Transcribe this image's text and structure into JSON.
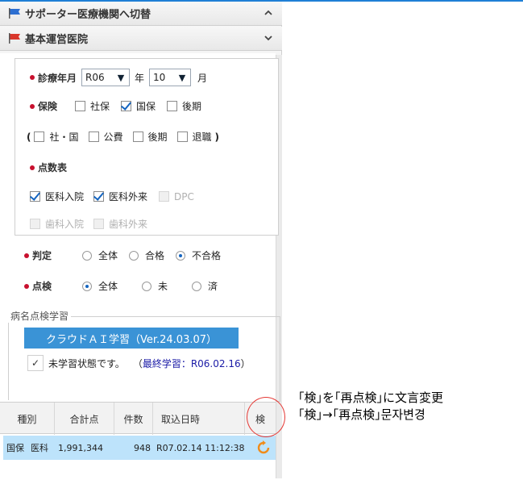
{
  "header1": {
    "title": "サポーター医療機関へ切替",
    "chevron": "up-chevron"
  },
  "header2": {
    "title": "基本運営医院",
    "chevron": "down-chevron"
  },
  "shinryo": {
    "label": "診療年月",
    "year_value": "R06",
    "year_unit": "年",
    "month_value": "10",
    "month_unit": "月"
  },
  "hoken": {
    "label": "保険",
    "options": [
      {
        "label": "社保",
        "checked": false
      },
      {
        "label": "国保",
        "checked": true
      },
      {
        "label": "後期",
        "checked": false
      }
    ],
    "paren_open": "(",
    "paren_close": ")",
    "sub_options": [
      {
        "label": "社・国",
        "checked": false
      },
      {
        "label": "公費",
        "checked": false
      },
      {
        "label": "後期",
        "checked": false
      },
      {
        "label": "退職",
        "checked": false
      }
    ]
  },
  "tensu": {
    "label": "点数表",
    "options": [
      {
        "label": "医科入院",
        "checked": true,
        "disabled": false
      },
      {
        "label": "医科外来",
        "checked": true,
        "disabled": false
      },
      {
        "label": "DPC",
        "checked": false,
        "disabled": true
      },
      {
        "label": "歯科入院",
        "checked": false,
        "disabled": true
      },
      {
        "label": "歯科外来",
        "checked": false,
        "disabled": true
      }
    ]
  },
  "hantei": {
    "label": "判定",
    "options": [
      "全体",
      "合格",
      "不合格"
    ],
    "selected": "不合格"
  },
  "tenken": {
    "label": "点検",
    "options": [
      "全体",
      "未",
      "済"
    ],
    "selected": "全体"
  },
  "ai": {
    "legend": "病名点検学習",
    "button_label": "クラウドＡＩ学習（Ver.24.03.07）",
    "check_mark": "✓",
    "status_text": "未学習状態です。",
    "last_open": "（",
    "last_label": "最終学習：R06.02.16",
    "last_close": "）"
  },
  "table": {
    "headers": [
      "種別",
      "合計点",
      "件数",
      "取込日時",
      "検"
    ],
    "rows": [
      {
        "type1": "国保",
        "type2": "医科",
        "total": "1,991,344",
        "count": "948",
        "datetime": "R07.02.14 11:12:38",
        "action_icon": "refresh-icon"
      }
    ]
  },
  "annotations": {
    "line1": "｢検｣を｢再点検｣に文言変更",
    "line2": "｢検｣→｢再点検｣문자변경"
  },
  "colors": {
    "accent": "#1f7fd6",
    "ai_bar": "#3a93d6",
    "selected_row": "#bde3fb",
    "required_dot": "#c8102e",
    "circle": "#e53935",
    "refresh": "#f08c1a",
    "link": "#1a1aa6"
  }
}
